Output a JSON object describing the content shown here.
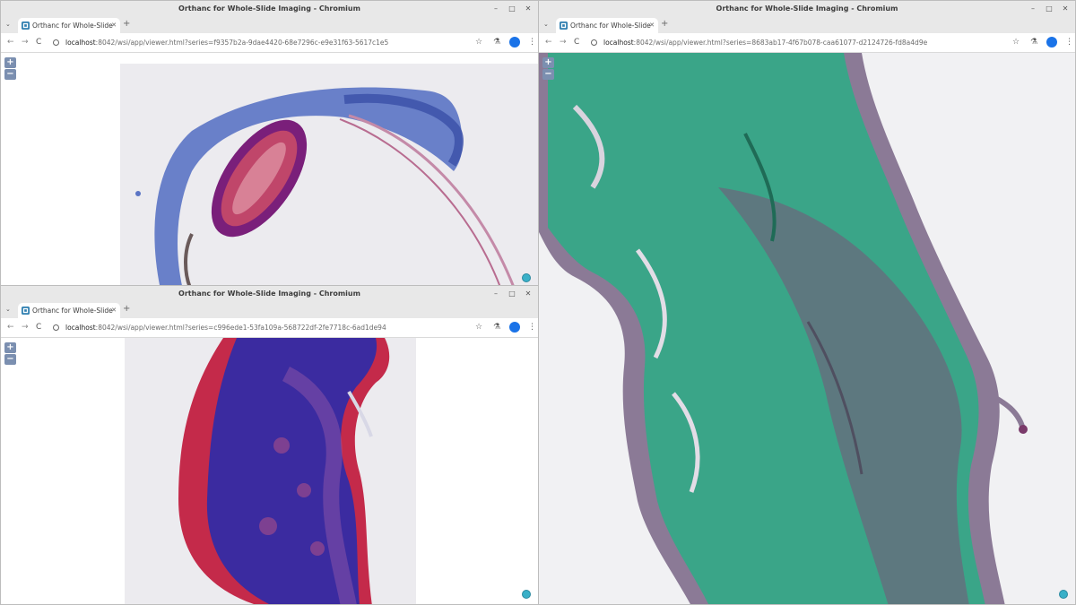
{
  "windows": [
    {
      "id": "top-left",
      "title": "Orthanc for Whole-Slide Imaging - Chromium",
      "tab_label": "Orthanc for Whole-Slide",
      "url_host": "localhost",
      "url_path": ":8042/wsi/app/viewer.html?series=f9357b2a-9dae4420-68e7296c-e9e31f63-5617c1e5"
    },
    {
      "id": "bottom-left",
      "title": "Orthanc for Whole-Slide Imaging - Chromium",
      "tab_label": "Orthanc for Whole-Slide",
      "url_host": "localhost",
      "url_path": ":8042/wsi/app/viewer.html?series=c996ede1-53fa109a-568722df-2fe7718c-6ad1de94"
    },
    {
      "id": "right",
      "title": "Orthanc for Whole-Slide Imaging - Chromium",
      "tab_label": "Orthanc for Whole-Slide",
      "url_host": "localhost",
      "url_path": ":8042/wsi/app/viewer.html?series=8683ab17-4f67b078-caa61077-d2124726-fd8a4d9e"
    }
  ],
  "controls": {
    "zoom_in": "+",
    "zoom_out": "−",
    "back": "←",
    "forward": "→",
    "reload": "C",
    "bookmark": "☆",
    "labs": "⚗",
    "menu": "⋮",
    "tab_close": "✕",
    "new_tab": "+",
    "tab_dropdown": "⌄",
    "minimize": "–",
    "maximize": "□",
    "close": "✕"
  },
  "colors": {
    "stain_blue": "#4a63b8",
    "stain_magenta": "#b03a7a",
    "stain_green": "#3aa588",
    "stain_red": "#c0284a",
    "stain_purple": "#3a2a9a"
  }
}
